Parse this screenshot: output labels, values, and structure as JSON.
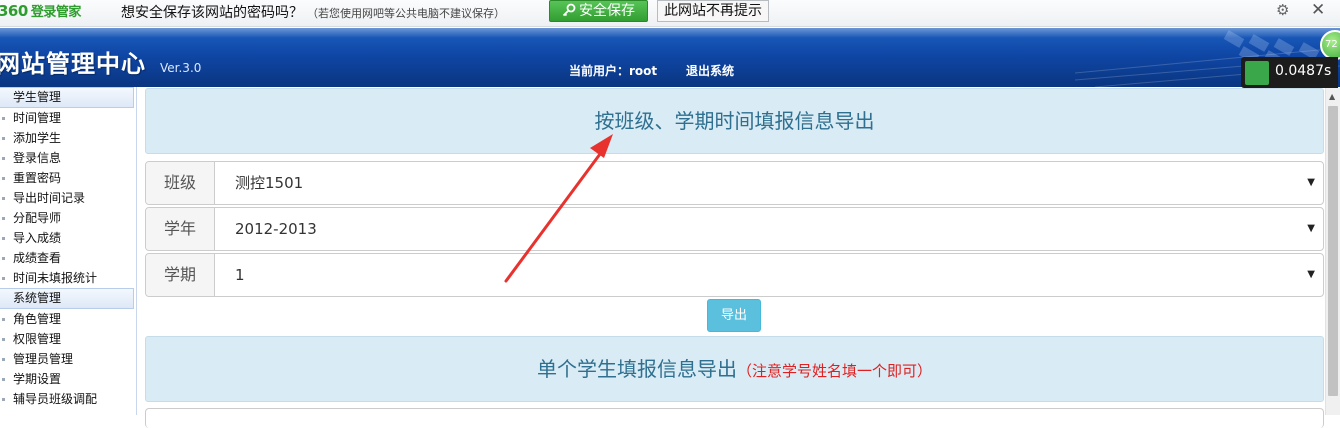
{
  "password_bar": {
    "logo_num": "360",
    "logo_brand": "登录管家",
    "question": "想安全保存该网站的密码吗？",
    "note": "（若您使用网吧等公共电脑不建议保存）",
    "save_label": "安全保存",
    "never_label": "此网站不再提示",
    "gear_icon": "⚙",
    "close_icon": "✕"
  },
  "header": {
    "title": "网站管理中心",
    "version": "Ver.3.0",
    "current_user": "当前用户：root",
    "logout": "退出系统",
    "speed": "0.0487s",
    "speed_badge": "72"
  },
  "sidebar": {
    "sections": [
      {
        "title": "学生管理",
        "items": [
          "时间管理",
          "添加学生",
          "登录信息",
          "重置密码",
          "导出时间记录",
          "分配导师",
          "导入成绩",
          "成绩查看",
          "时间未填报统计"
        ]
      },
      {
        "title": "系统管理",
        "items": [
          "角色管理",
          "权限管理",
          "管理员管理",
          "学期设置",
          "辅导员班级调配"
        ]
      }
    ]
  },
  "main": {
    "panel1_title": "按班级、学期时间填报信息导出",
    "fields": [
      {
        "label": "班级",
        "value": "测控1501"
      },
      {
        "label": "学年",
        "value": "2012-2013"
      },
      {
        "label": "学期",
        "value": "1"
      }
    ],
    "caret": "▼",
    "export_label": "导出",
    "panel2_title": "单个学生填报信息导出",
    "panel2_hint": "（注意学号姓名填一个即可）"
  },
  "colors": {
    "header_blue": "#0f47a6",
    "panel_bg": "#d9ecf5",
    "accent_btn": "#5bc0de",
    "save_green": "#319e31",
    "arrow_red": "#e8322e"
  }
}
